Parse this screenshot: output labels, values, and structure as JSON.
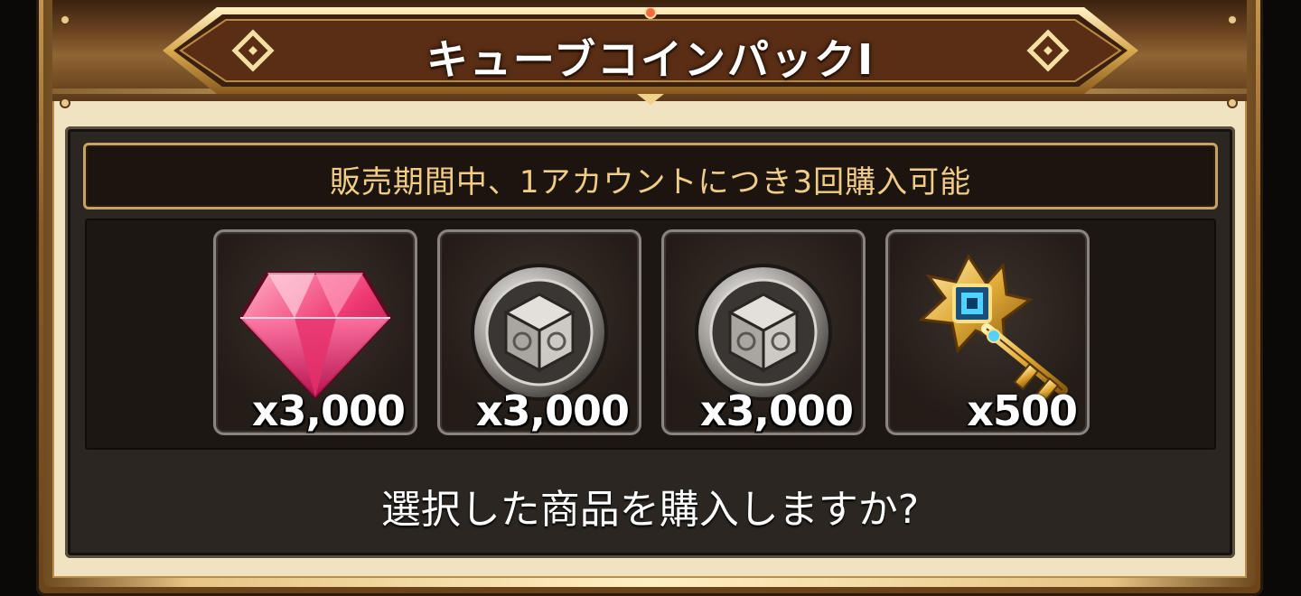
{
  "window": {
    "title": "キューブコインパックⅠ"
  },
  "banner": {
    "text": "販売期間中、1アカウントにつき3回購入可能"
  },
  "items": [
    {
      "icon": "red-gem-icon",
      "quantity": "x3,000"
    },
    {
      "icon": "cube-coin-icon",
      "quantity": "x3,000"
    },
    {
      "icon": "cube-coin-icon",
      "quantity": "x3,000"
    },
    {
      "icon": "golden-key-icon",
      "quantity": "x500"
    }
  ],
  "prompt": {
    "text": "選択した商品を購入しますか?"
  },
  "colors": {
    "banner_text": "#f1cc86",
    "gold_trim": "#e7c584",
    "panel_bg": "#2b2621"
  }
}
